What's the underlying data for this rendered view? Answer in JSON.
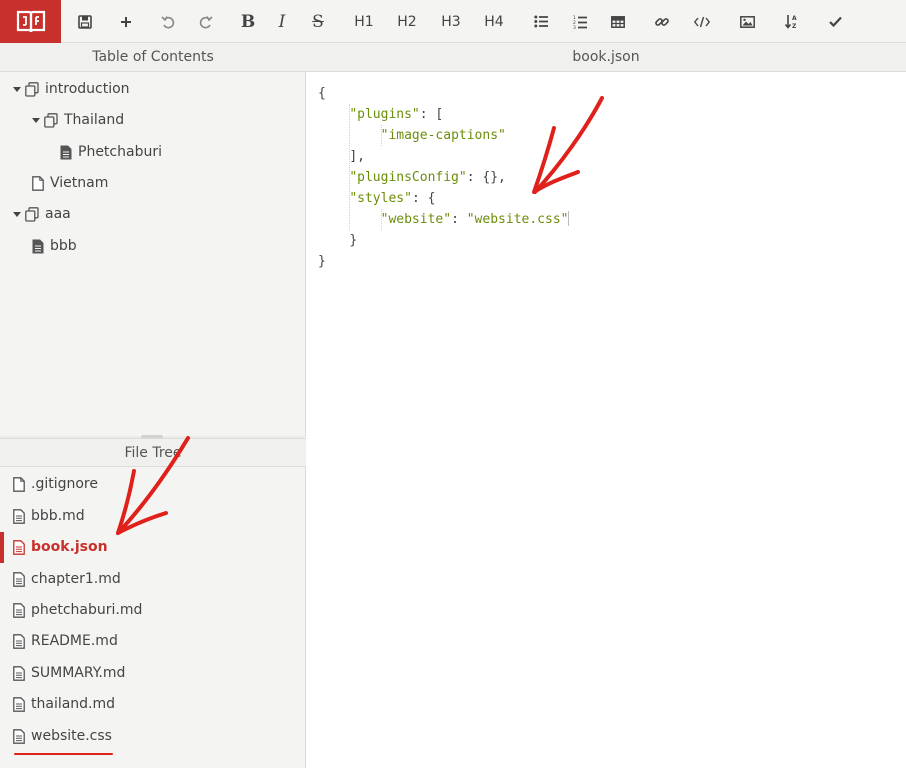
{
  "toolbar": {
    "logo_icon": "book-icon",
    "h1": "H1",
    "h2": "H2",
    "h3": "H3",
    "h4": "H4",
    "bold": "B",
    "italic": "I",
    "strike": "S"
  },
  "toc": {
    "title": "Table of Contents",
    "items": [
      {
        "label": "introduction"
      },
      {
        "label": "Thailand"
      },
      {
        "label": "Phetchaburi"
      },
      {
        "label": "Vietnam"
      },
      {
        "label": "aaa"
      },
      {
        "label": "bbb"
      }
    ]
  },
  "file_tree": {
    "title": "File Tree",
    "files": [
      {
        "label": ".gitignore"
      },
      {
        "label": "bbb.md"
      },
      {
        "label": "book.json"
      },
      {
        "label": "chapter1.md"
      },
      {
        "label": "phetchaburi.md"
      },
      {
        "label": "README.md"
      },
      {
        "label": "SUMMARY.md"
      },
      {
        "label": "thailand.md"
      },
      {
        "label": "website.css"
      }
    ],
    "active_file": "book.json"
  },
  "editor": {
    "title": "book.json",
    "lines": {
      "l1": "{",
      "l2_key": "\"plugins\"",
      "l2_rest": ": [",
      "l3_str": "\"image-captions\"",
      "l4": "],",
      "l5_key": "\"pluginsConfig\"",
      "l5_rest": ": {},",
      "l6_key": "\"styles\"",
      "l6_rest": ": {",
      "l7_key": "\"website\"",
      "l7_sep": ": ",
      "l7_val": "\"website.css\"",
      "l8": "}",
      "l9": "}"
    }
  },
  "colors": {
    "brand": "#c8302b",
    "string": "#6b8e0a",
    "annotation": "#e0201b"
  }
}
